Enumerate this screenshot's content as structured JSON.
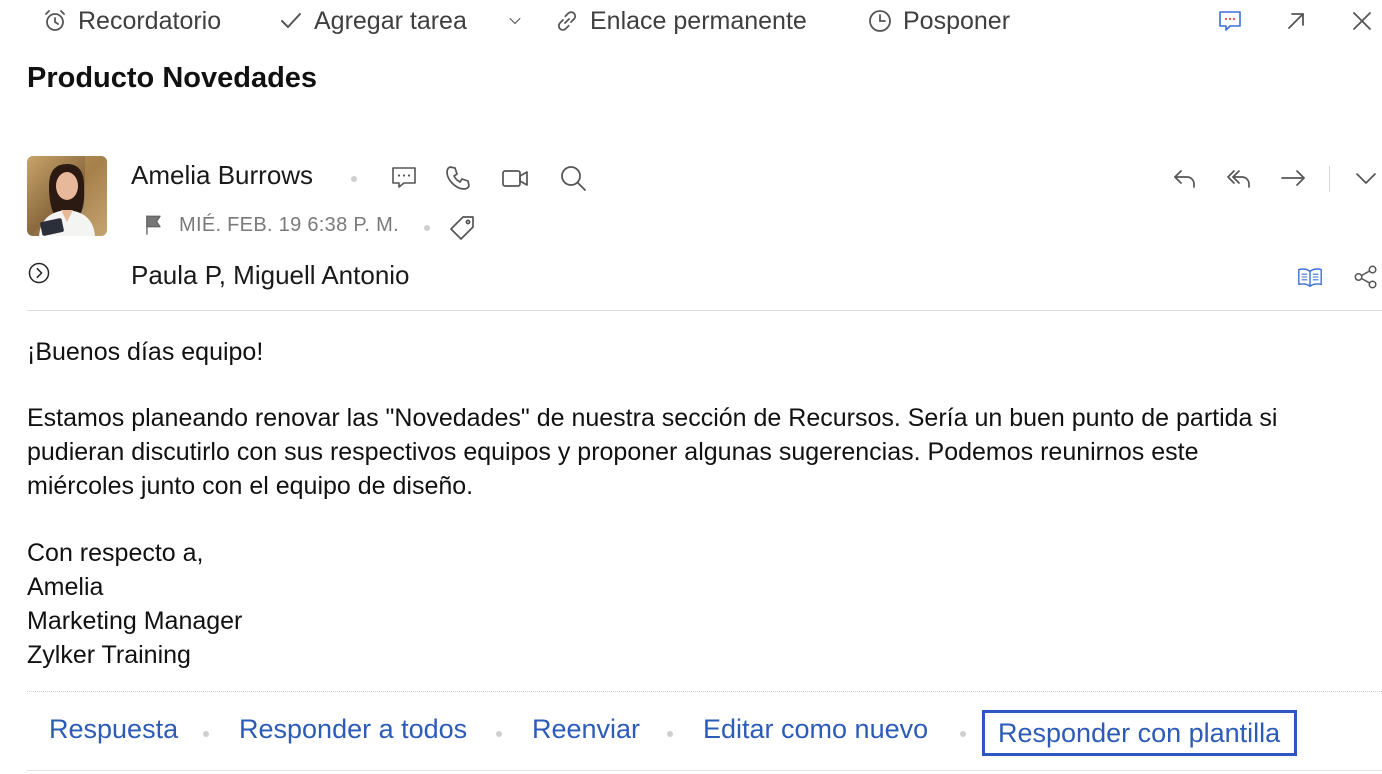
{
  "toolbar": {
    "reminder_label": "Recordatorio",
    "add_task_label": "Agregar tarea",
    "permalink_label": "Enlace permanente",
    "snooze_label": "Posponer"
  },
  "email": {
    "subject": "Producto Novedades",
    "sender_name": "Amelia Burrows",
    "date": "MIÉ. FEB. 19 6:38 P. M.",
    "recipient_1": "Paula P",
    "recipient_sep": ", ",
    "recipient_2": "Miguell Antonio",
    "body": {
      "greeting": "¡Buenos días equipo!",
      "paragraph_line_1": "Estamos planeando renovar las \"Novedades\" de nuestra sección de Recursos. Sería un buen punto de partida si",
      "paragraph_line_2": "pudieran discutirlo con sus respectivos equipos y proponer algunas sugerencias. Podemos reunirnos este",
      "paragraph_line_3": "miércoles junto con el equipo de diseño.",
      "signoff": "Con respecto a,",
      "sig_name": "Amelia",
      "sig_title": "Marketing Manager",
      "sig_company": "Zylker Training"
    }
  },
  "actions": {
    "reply": "Respuesta",
    "reply_all": "Responder a todos",
    "forward": "Reenviar",
    "edit_as_new": "Editar como nuevo",
    "reply_with_template": "Responder con plantilla"
  },
  "colors": {
    "link_blue": "#2c5bb8",
    "highlight_border": "#2d55c4",
    "icon_blue": "#3b6fd6"
  }
}
